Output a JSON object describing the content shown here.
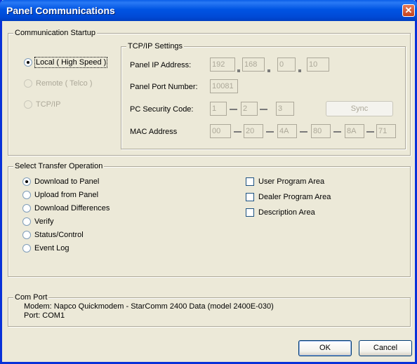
{
  "window": {
    "title": "Panel Communications",
    "close_glyph": "✕"
  },
  "startup": {
    "legend": "Communication Startup",
    "options": [
      {
        "label": "Local ( High Speed )",
        "selected": true,
        "enabled": true
      },
      {
        "label": "Remote ( Telco )",
        "selected": false,
        "enabled": false
      },
      {
        "label": "TCP/IP",
        "selected": false,
        "enabled": false
      }
    ]
  },
  "tcpip": {
    "legend": "TCP/IP Settings",
    "ip_label": "Panel IP Address:",
    "ip": [
      "192",
      "168",
      "0",
      "10"
    ],
    "port_label": "Panel Port Number:",
    "port": "10081",
    "security_label": "PC Security Code:",
    "security": [
      "1",
      "2",
      "3"
    ],
    "sync_label": "Sync",
    "mac_label": "MAC Address",
    "mac": [
      "00",
      "20",
      "4A",
      "80",
      "8A",
      "71"
    ]
  },
  "transfer": {
    "legend": "Select Transfer Operation",
    "operations": [
      {
        "label": "Download to Panel",
        "selected": true
      },
      {
        "label": "Upload from Panel",
        "selected": false
      },
      {
        "label": "Download Differences",
        "selected": false
      },
      {
        "label": "Verify",
        "selected": false
      },
      {
        "label": "Status/Control",
        "selected": false
      },
      {
        "label": "Event Log",
        "selected": false
      }
    ],
    "areas": [
      {
        "label": "User Program Area",
        "checked": false
      },
      {
        "label": "Dealer Program Area",
        "checked": false
      },
      {
        "label": "Description Area",
        "checked": false
      }
    ]
  },
  "comport": {
    "legend": "Com Port",
    "modem": "Modem: Napco Quickmodem - StarComm 2400 Data (model 2400E-030)",
    "port": "Port: COM1"
  },
  "buttons": {
    "ok": "OK",
    "cancel": "Cancel"
  }
}
